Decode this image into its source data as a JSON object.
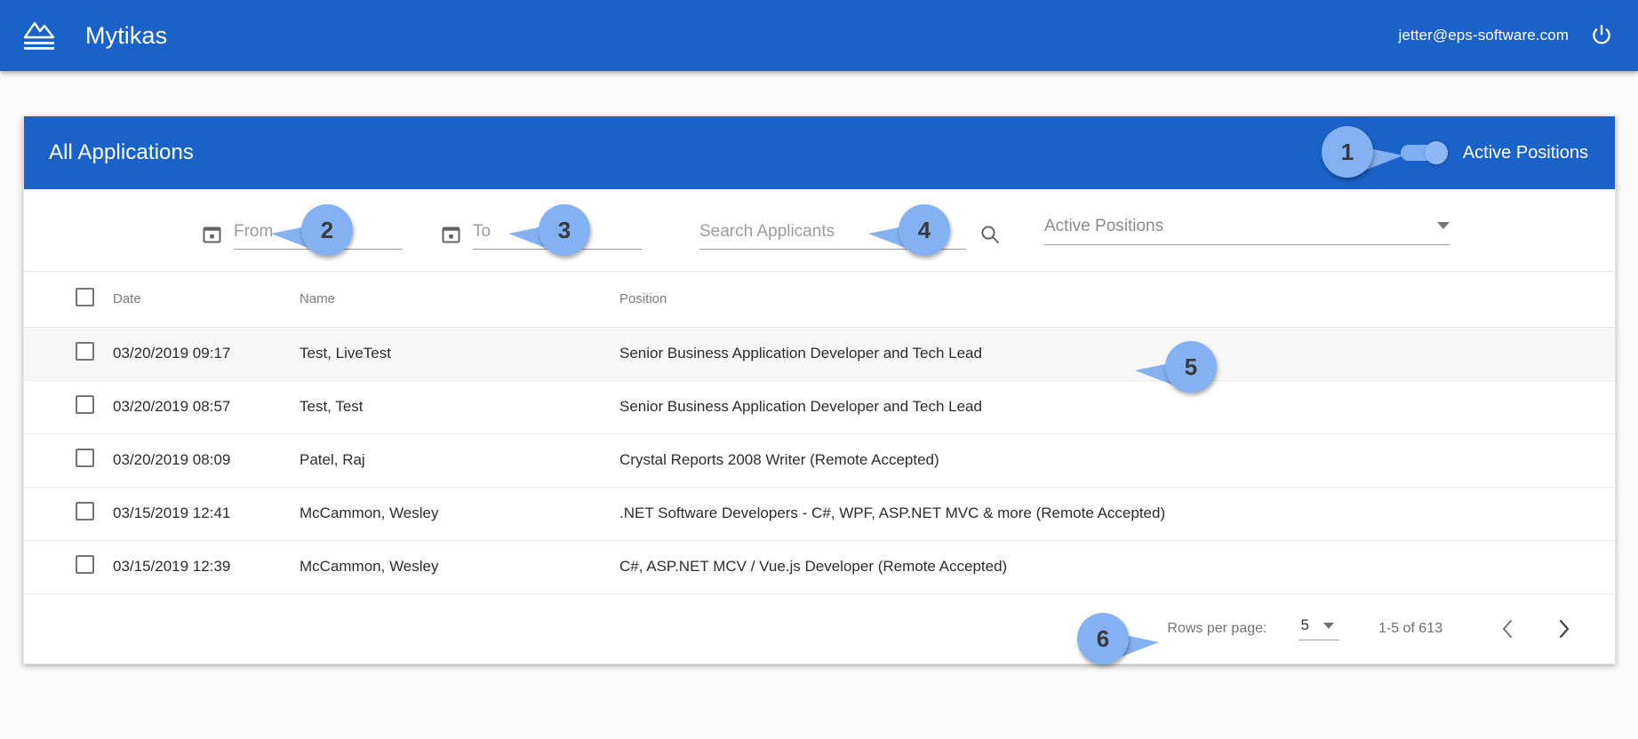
{
  "appbar": {
    "brand": "Mytikas",
    "logo_icon": "mountain-logo-icon",
    "user_email": "jetter@eps-software.com",
    "power_icon": "power-icon",
    "bg_color": "#1a62c8"
  },
  "card": {
    "title": "All Applications",
    "toggle": {
      "label": "Active Positions",
      "checked": true
    }
  },
  "filters": {
    "from": {
      "placeholder": "From",
      "value": "",
      "icon": "calendar-icon"
    },
    "to": {
      "placeholder": "To",
      "value": "",
      "icon": "calendar-icon"
    },
    "search": {
      "placeholder": "Search Applicants",
      "value": "",
      "icon": "search-icon"
    },
    "positions_select": {
      "value": "Active Positions",
      "icon": "chevron-down-icon"
    }
  },
  "table": {
    "columns": [
      "",
      "Date",
      "Name",
      "Position"
    ],
    "rows": [
      {
        "checked": false,
        "date": "03/20/2019 09:17",
        "name": "Test, LiveTest",
        "position": "Senior Business Application Developer and Tech Lead",
        "highlighted": true
      },
      {
        "checked": false,
        "date": "03/20/2019 08:57",
        "name": "Test, Test",
        "position": "Senior Business Application Developer and Tech Lead",
        "highlighted": false
      },
      {
        "checked": false,
        "date": "03/20/2019 08:09",
        "name": "Patel, Raj",
        "position": "Crystal Reports 2008 Writer (Remote Accepted)",
        "highlighted": false
      },
      {
        "checked": false,
        "date": "03/15/2019 12:41",
        "name": "McCammon, Wesley",
        "position": ".NET Software Developers - C#, WPF, ASP.NET MVC & more (Remote Accepted)",
        "highlighted": false
      },
      {
        "checked": false,
        "date": "03/15/2019 12:39",
        "name": "McCammon, Wesley",
        "position": "C#, ASP.NET MCV / Vue.js Developer (Remote Accepted)",
        "highlighted": false
      }
    ]
  },
  "paginator": {
    "rows_per_page_label": "Rows per page:",
    "rows_per_page_value": "5",
    "range_label": "1-5 of 613",
    "prev_icon": "chevron-left-icon",
    "next_icon": "chevron-right-icon"
  },
  "callouts": [
    {
      "number": "1"
    },
    {
      "number": "2"
    },
    {
      "number": "3"
    },
    {
      "number": "4"
    },
    {
      "number": "5"
    },
    {
      "number": "6"
    }
  ],
  "colors": {
    "primary": "#1a62c8",
    "callout": "#84b1f2",
    "page_bg": "#fafafa"
  }
}
